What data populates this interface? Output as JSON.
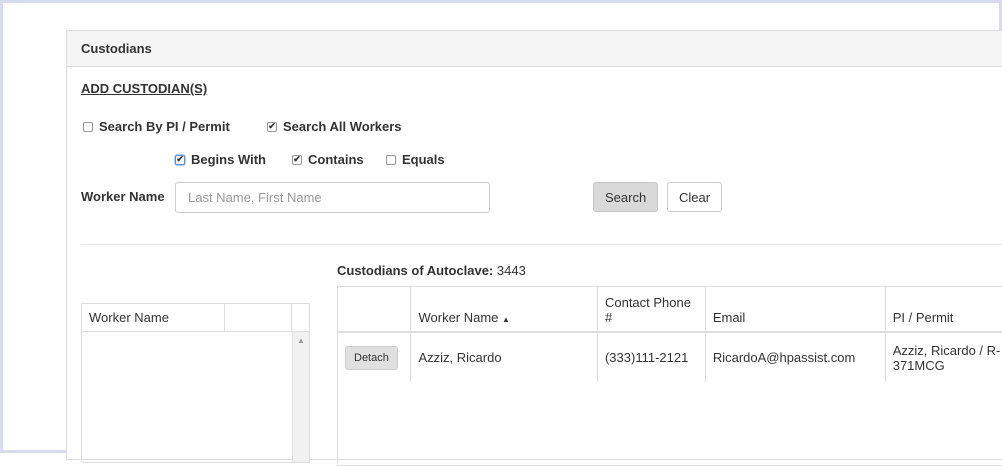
{
  "panel": {
    "title": "Custodians"
  },
  "add_link": "ADD CUSTODIAN(S)",
  "search_options": {
    "by_pi": {
      "label": "Search By PI / Permit",
      "checked": false
    },
    "all_workers": {
      "label": "Search All Workers",
      "checked": true
    },
    "begins_with": {
      "label": "Begins With",
      "checked": true
    },
    "contains": {
      "label": "Contains",
      "checked": true
    },
    "equals": {
      "label": "Equals",
      "checked": false
    }
  },
  "worker_name": {
    "label": "Worker Name",
    "placeholder": "Last Name, First Name",
    "value": ""
  },
  "buttons": {
    "search": "Search",
    "clear": "Clear"
  },
  "left_table": {
    "header": "Worker Name"
  },
  "custodians": {
    "title": "Custodians of Autoclave:",
    "id": "3443",
    "columns": [
      "",
      "Worker Name",
      "Contact Phone #",
      "Email",
      "PI / Permit"
    ],
    "rows": [
      {
        "action": "Detach",
        "worker_name": "Azziz, Ricardo",
        "phone": "(333)111-2121",
        "email": "RicardoA@hpassist.com",
        "pi_permit": "Azziz, Ricardo / R-371MCG"
      }
    ]
  },
  "icons": {
    "sort": "sort-asc-icon",
    "scroll_up": "scroll-up-arrow-icon",
    "check": "checkmark-icon"
  }
}
